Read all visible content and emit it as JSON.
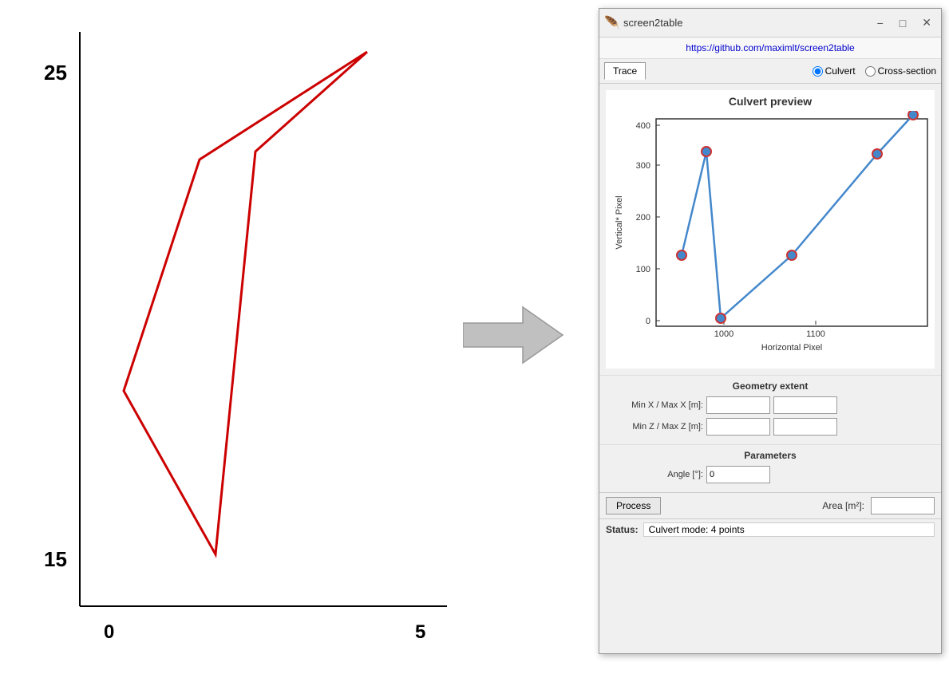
{
  "window": {
    "title": "screen2table",
    "url": "https://github.com/maximlt/screen2table",
    "minimize_label": "−",
    "maximize_label": "□",
    "close_label": "✕"
  },
  "tabs": {
    "trace_label": "Trace",
    "culvert_label": "Culvert",
    "cross_section_label": "Cross-section"
  },
  "chart": {
    "title": "Culvert preview",
    "x_axis_label": "Horizontal Pixel",
    "y_axis_label": "Vertical* Pixel"
  },
  "geometry": {
    "section_title": "Geometry extent",
    "min_x_label": "Min X / Max X [m]:",
    "min_z_label": "Min Z / Max Z [m]:",
    "min_x_value": "",
    "max_x_value": "",
    "min_z_value": "",
    "max_z_value": ""
  },
  "parameters": {
    "section_title": "Parameters",
    "angle_label": "Angle [°]:",
    "angle_value": "0"
  },
  "bottom": {
    "process_label": "Process",
    "area_label": "Area [m²]:",
    "area_value": ""
  },
  "status": {
    "label": "Status:",
    "value": "Culvert mode: 4 points"
  },
  "left_chart": {
    "y_label_25": "25",
    "y_label_15": "15",
    "x_label_0": "0",
    "x_label_5": "5"
  },
  "arrow": {
    "label": "→"
  }
}
